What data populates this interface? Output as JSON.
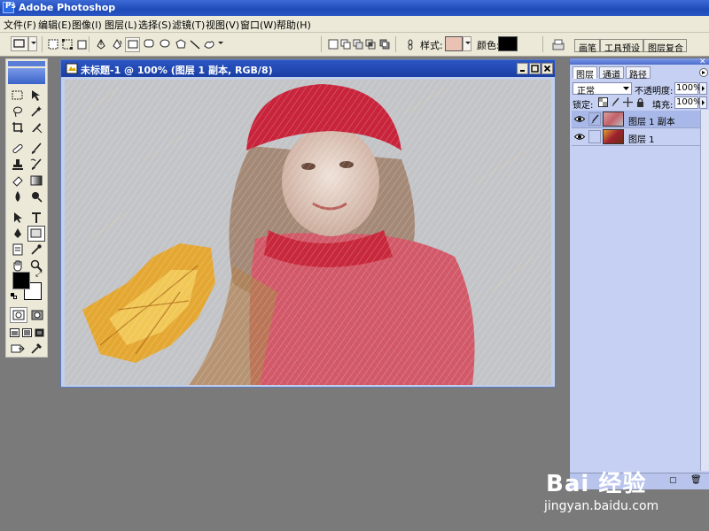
{
  "app": {
    "title": "Adobe Photoshop",
    "icon_letter": "Ps"
  },
  "menu": [
    {
      "label": "文件(F)"
    },
    {
      "label": "编辑(E)"
    },
    {
      "label": "图像(I)"
    },
    {
      "label": "图层(L)"
    },
    {
      "label": "选择(S)"
    },
    {
      "label": "滤镜(T)"
    },
    {
      "label": "视图(V)"
    },
    {
      "label": "窗口(W)"
    },
    {
      "label": "帮助(H)"
    }
  ],
  "options_bar": {
    "style_label": "样式:",
    "color_label": "颜色:",
    "style_color": "#e9c2b4",
    "fill_color": "#000000"
  },
  "palette_well": {
    "tabs": [
      "画笔",
      "工具预设",
      "图层复合"
    ]
  },
  "document": {
    "title": "未标题-1 @ 100% (图层 1 副本, RGB/8)"
  },
  "layers_panel": {
    "tabs": [
      "图层",
      "通道",
      "路径"
    ],
    "blend_mode": "正常",
    "opacity_label": "不透明度:",
    "opacity_value": "100%",
    "lock_label": "锁定:",
    "fill_label": "填充:",
    "fill_value": "100%",
    "layers": [
      {
        "name": "图层 1 副本",
        "selected": true
      },
      {
        "name": "图层 1",
        "selected": false
      }
    ]
  },
  "toolbox": {
    "foreground_color": "#000000",
    "background_color": "#ffffff"
  },
  "watermark": {
    "logo": "Bai 经验",
    "url": "jingyan.baidu.com"
  }
}
